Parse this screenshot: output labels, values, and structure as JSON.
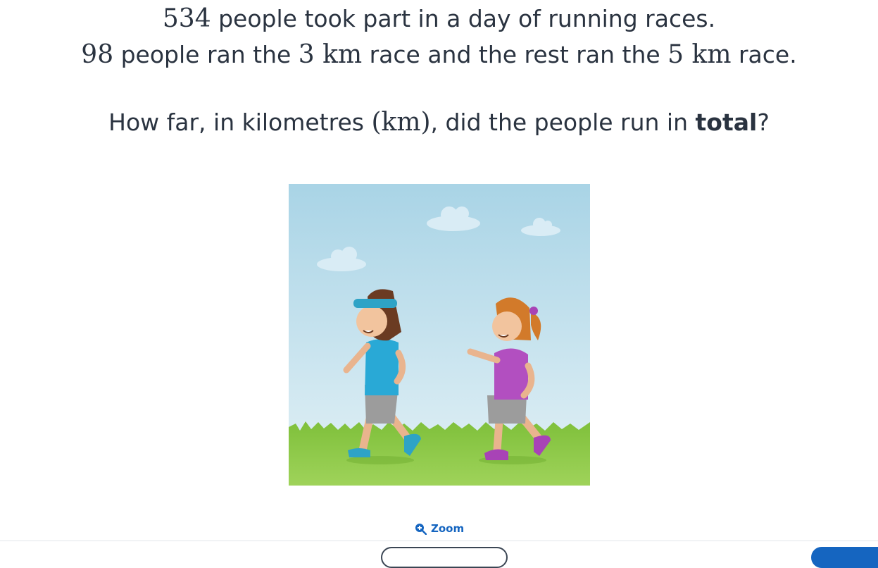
{
  "question": {
    "line1": {
      "num": "534",
      "text": " people took part in a day of running races."
    },
    "line2": {
      "num1": "98",
      "t1": " people ran the ",
      "num2": "3 km",
      "t2": " race and the rest ran the ",
      "num3": "5 km",
      "t3": " race."
    },
    "line3": {
      "t1": "How far, in kilometres ",
      "unit": "(km)",
      "t2": ", did the people run in ",
      "bold": "total",
      "t3": "?"
    }
  },
  "zoom_label": "Zoom",
  "icons": {
    "zoom": "zoom-in-icon"
  },
  "colors": {
    "accent": "#1565c0",
    "text": "#2a3340",
    "sky": "#b7dcec",
    "grass": "#8cc63f"
  }
}
